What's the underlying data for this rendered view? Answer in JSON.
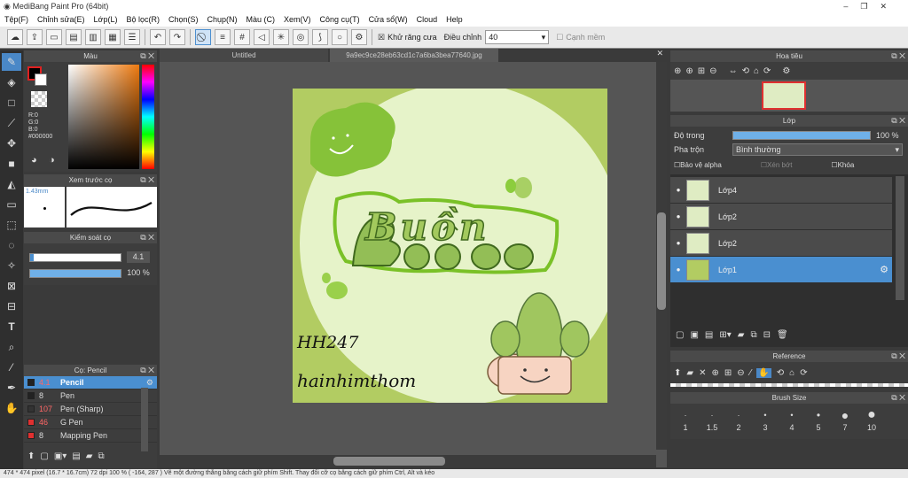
{
  "app": {
    "title": "MediBang Paint Pro (64bit)"
  },
  "menu": [
    "Tệp(F)",
    "Chỉnh sửa(E)",
    "Lớp(L)",
    "Bộ lọc(R)",
    "Chọn(S)",
    "Chụp(N)",
    "Màu (C)",
    "Xem(V)",
    "Công cụ(T)",
    "Cửa sổ(W)",
    "Cloud",
    "Help"
  ],
  "toolbar": {
    "antialias_label": "Khử răng cưa",
    "correction_label": "Điều chỉnh",
    "correction_value": "40",
    "smooth_label": "Cạnh mềm"
  },
  "color_panel": {
    "title": "Màu",
    "r": "R:0",
    "g": "G:0",
    "b": "B:0",
    "hex": "#000000"
  },
  "brush_preview": {
    "title": "Xem trước cọ",
    "size": "1.43mm"
  },
  "brush_control": {
    "title": "Kiểm soát cọ",
    "size_value": "4.1",
    "opacity_value": "100 %"
  },
  "brush_list": {
    "title": "Cọ: Pencil",
    "items": [
      {
        "size": "4.1",
        "name": "Pencil",
        "color": "#222222",
        "selected": true
      },
      {
        "size": "8",
        "name": "Pen",
        "color": "#222222",
        "selected": false
      },
      {
        "size": "107",
        "name": "Pen (Sharp)",
        "color": "#333333",
        "selected": false
      },
      {
        "size": "46",
        "name": "G Pen",
        "color": "#e03030",
        "selected": false
      },
      {
        "size": "8",
        "name": "Mapping Pen",
        "color": "#e03030",
        "selected": false
      }
    ]
  },
  "tabs": [
    "Untitled",
    "9a9ec9ce28eb63cd1c7a6ba3bea77640.jpg"
  ],
  "artwork": {
    "word": "Buồn",
    "signature1": "HH247",
    "signature2": "hainhimthom"
  },
  "navigator": {
    "title": "Hoa tiêu"
  },
  "layer_panel": {
    "title": "Lớp",
    "opacity_label": "Độ trong",
    "opacity_value": "100 %",
    "blend_label": "Pha trộn",
    "blend_value": "Bình thường",
    "protect_alpha": "Bảo vệ alpha",
    "clipping": "Xén bớt",
    "lock": "Khóa",
    "layers": [
      {
        "name": "Lớp4",
        "selected": false
      },
      {
        "name": "Lớp2",
        "selected": false
      },
      {
        "name": "Lớp2",
        "selected": false
      },
      {
        "name": "Lớp1",
        "selected": true
      }
    ]
  },
  "reference": {
    "title": "Reference"
  },
  "brush_size": {
    "title": "Brush Size",
    "sizes": [
      "1",
      "1.5",
      "2",
      "3",
      "4",
      "5",
      "7",
      "10"
    ]
  },
  "status": {
    "text": "474 * 474 pixel   (16.7 * 16.7cm)   72 dpi   100 %   ( -164, 287 )   Vẽ một đường thẳng bằng cách giữ phím Shift. Thay đổi cỡ cọ bằng cách giữ phím Ctrl, Alt và kéo"
  }
}
